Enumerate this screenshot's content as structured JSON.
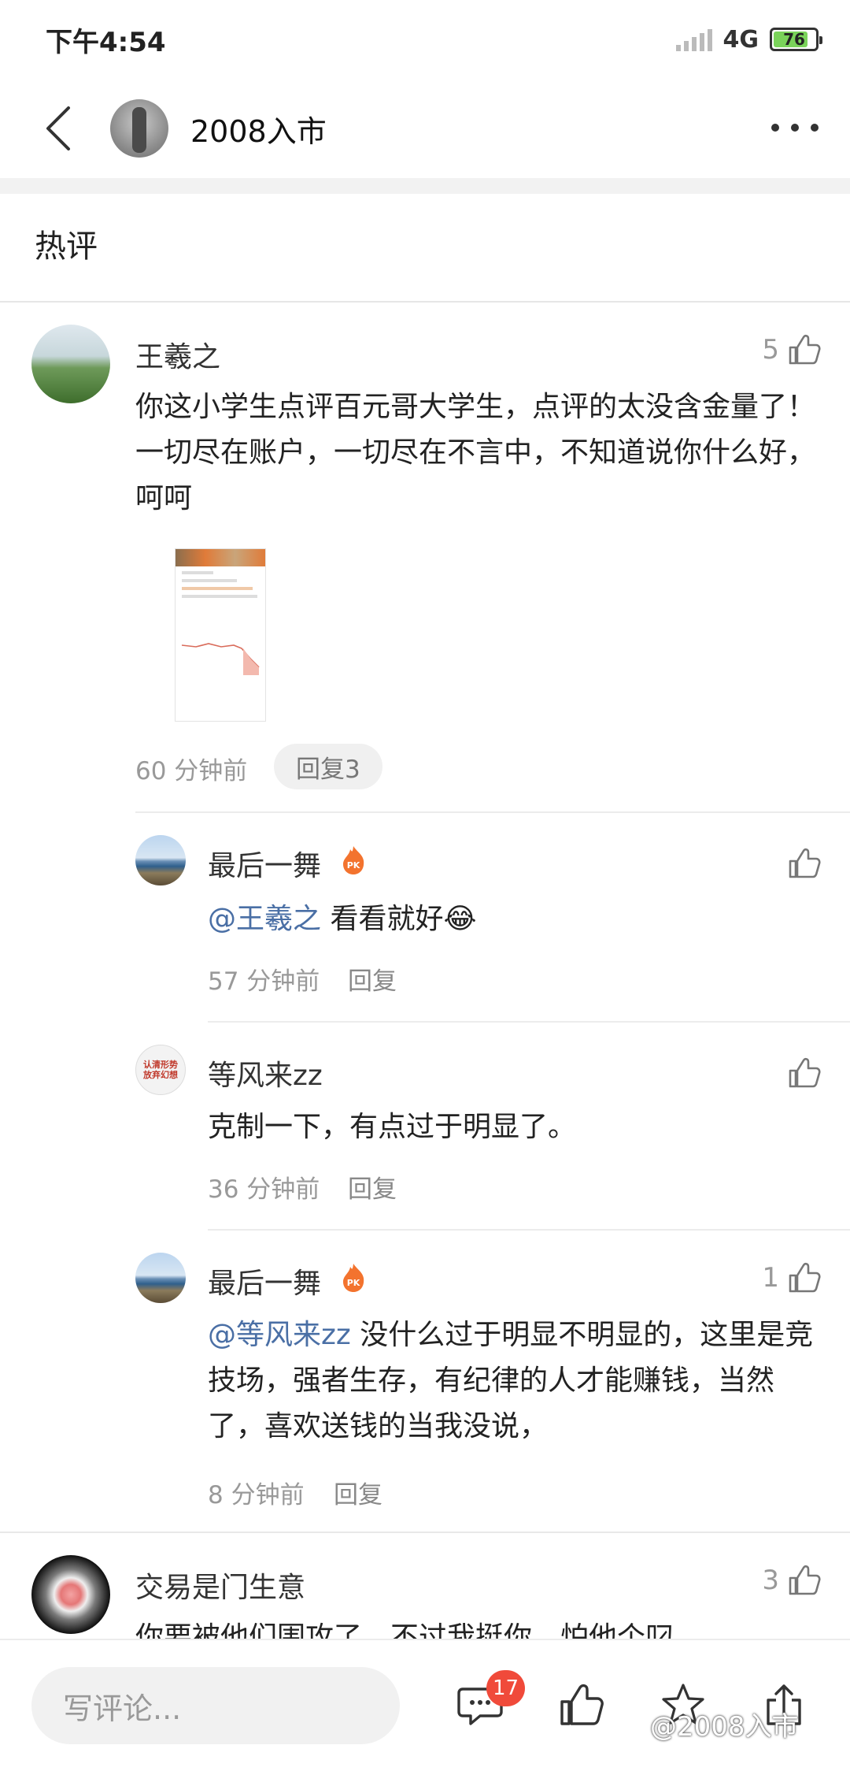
{
  "status_bar": {
    "time": "下午4:54",
    "network": "4G",
    "battery": "76"
  },
  "header": {
    "title": "2008入市"
  },
  "section": {
    "title": "热评"
  },
  "comments": [
    {
      "name": "王羲之",
      "likes": "5",
      "text": "你这小学生点评百元哥大学生，点评的太没含金量了！一切尽在账户，一切尽在不言中，不知道说你什么好，呵呵",
      "time": "60 分钟前",
      "reply_label": "回复3"
    },
    {
      "name": "交易是门生意",
      "likes": "3",
      "text": "你要被他们围攻了，不过我挺你，怕他个叼"
    }
  ],
  "replies": [
    {
      "name": "最后一舞",
      "mention": "@王羲之",
      "text": " 看看就好😂",
      "time": "57 分钟前",
      "reply_label": "回复",
      "likes": ""
    },
    {
      "name": "等风来zz",
      "text": "克制一下，有点过于明显了。",
      "time": "36 分钟前",
      "reply_label": "回复",
      "likes": "",
      "avatar_text": "认清形势 放弃幻想"
    },
    {
      "name": "最后一舞",
      "mention": "@等风来zz",
      "text": " 没什么过于明显不明显的，这里是竞技场，强者生存，有纪律的人才能赚钱，当然了，喜欢送钱的当我没说，",
      "time": "8 分钟前",
      "reply_label": "回复",
      "likes": "1"
    }
  ],
  "bottom_bar": {
    "input_placeholder": "写评论...",
    "comment_count": "17",
    "watermark": "@2008入市"
  }
}
